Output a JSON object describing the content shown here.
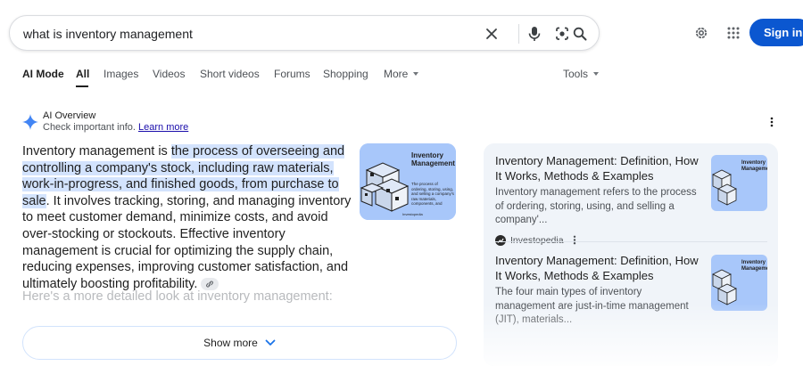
{
  "search": {
    "query": "what is inventory management"
  },
  "header": {
    "sign_in_label": "Sign in"
  },
  "tabs": [
    {
      "label": "AI Mode"
    },
    {
      "label": "All"
    },
    {
      "label": "Images"
    },
    {
      "label": "Videos"
    },
    {
      "label": "Short videos"
    },
    {
      "label": "Forums"
    },
    {
      "label": "Shopping"
    },
    {
      "label": "More"
    },
    {
      "label": "Tools"
    }
  ],
  "ai_overview": {
    "title": "AI Overview",
    "check_text": "Check important info.",
    "learn_more": "Learn more",
    "answer_intro": "Inventory management is ",
    "answer_highlight": "the process of overseeing and controlling a company's stock, including raw materials, work-in-progress, and finished goods, from purchase to sale",
    "answer_rest": ". It involves tracking, storing, and managing inventory to meet customer demand, minimize costs, and avoid over-stocking or stockouts. Effective inventory management is crucial for optimizing the supply chain, reducing expenses, improving customer satisfaction, and ultimately boosting profitability.",
    "followup": "Here's a more detailed look at inventory management:",
    "show_more": "Show more",
    "thumbnail": {
      "title_line1": "Inventory",
      "title_line2": "Management",
      "caption": "The process of ordering, storing, using, and selling a company's raw materials, components, and finished products.",
      "brand": "Investopedia"
    }
  },
  "sources": [
    {
      "title": "Inventory Management: Definition, How It Works, Methods & Examples",
      "snippet": "Inventory management refers to the process of ordering, storing, using, and selling a company'...",
      "source": "Investopedia"
    },
    {
      "title": "Inventory Management: Definition, How It Works, Methods & Examples",
      "snippet": "The four main types of inventory management are just-in-time management (JIT), materials..."
    }
  ],
  "colors": {
    "accent": "#0b57d0",
    "highlight": "#d3e3fd",
    "panel_bg": "#f0f4f9",
    "thumb_bg": "#a8c7fa"
  },
  "icons": [
    "clear-icon",
    "mic-icon",
    "lens-icon",
    "search-icon",
    "settings-icon",
    "apps-icon",
    "ai-sparkle-icon",
    "more-vert-icon",
    "link-icon",
    "chevron-down-icon",
    "investopedia-logo"
  ]
}
